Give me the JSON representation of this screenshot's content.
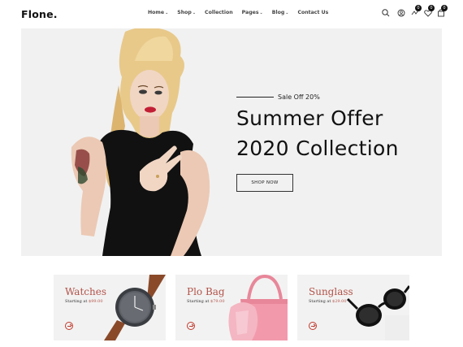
{
  "header": {
    "logo": "Flone.",
    "nav": [
      {
        "label": "Home",
        "dropdown": true
      },
      {
        "label": "Shop",
        "dropdown": true
      },
      {
        "label": "Collection",
        "dropdown": false
      },
      {
        "label": "Pages",
        "dropdown": true
      },
      {
        "label": "Blog",
        "dropdown": true
      },
      {
        "label": "Contact Us",
        "dropdown": false
      }
    ],
    "caret": "⌄",
    "icons": [
      {
        "name": "search-icon"
      },
      {
        "name": "account-icon"
      },
      {
        "name": "compare-icon",
        "count": "0"
      },
      {
        "name": "wishlist-icon",
        "count": "0"
      },
      {
        "name": "cart-icon",
        "count": "0"
      }
    ]
  },
  "hero": {
    "subtitle": "Sale Off 20%",
    "title_line1": "Summer Offer",
    "title_line2": "2020 Collection",
    "button": "SHOP NOW"
  },
  "cards": [
    {
      "title": "Watches",
      "starting": "Starting at",
      "price": "$99.00"
    },
    {
      "title": "Plo Bag",
      "starting": "Starting at",
      "price": "$79.00"
    },
    {
      "title": "Sunglass",
      "starting": "Starting at",
      "price": "$29.00"
    }
  ],
  "colors": {
    "accent": "#b2534a",
    "dark": "#111111",
    "hero_bg": "#f1f1f1",
    "card_bg": "#f2f2f2"
  }
}
